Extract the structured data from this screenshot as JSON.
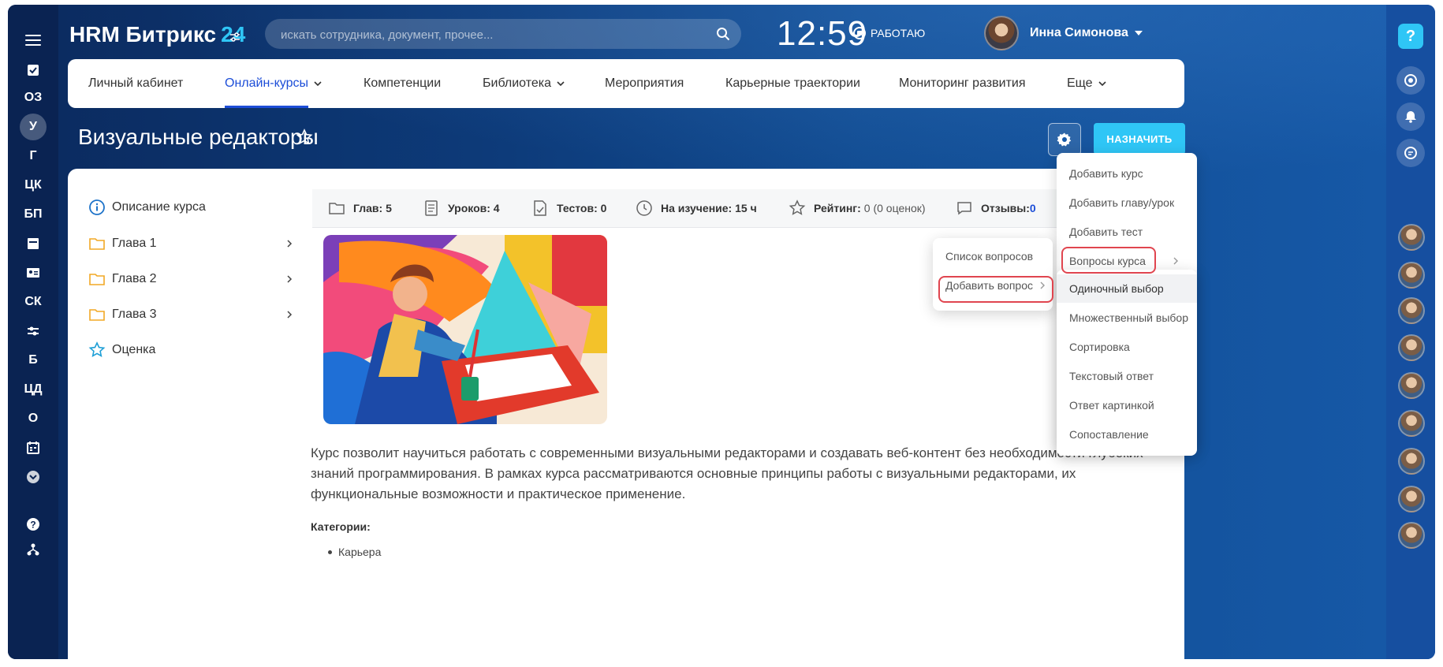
{
  "app": {
    "logo_main": "HRM Битрикс",
    "logo_suffix": "24"
  },
  "search": {
    "placeholder": "искать сотрудника, документ, прочее..."
  },
  "header": {
    "time": "12:59",
    "work_status": "РАБОТАЮ",
    "user_name": "Инна Симонова"
  },
  "left_rail": {
    "items": [
      "ОЗ",
      "У",
      "Г",
      "ЦК",
      "БП",
      "СК",
      "Б",
      "ЦД",
      "О"
    ]
  },
  "nav": {
    "items": [
      {
        "label": "Личный кабинет"
      },
      {
        "label": "Онлайн-курсы"
      },
      {
        "label": "Компетенции"
      },
      {
        "label": "Библиотека"
      },
      {
        "label": "Мероприятия"
      },
      {
        "label": "Карьерные траектории"
      },
      {
        "label": "Мониторинг развития"
      },
      {
        "label": "Еще"
      }
    ]
  },
  "page": {
    "title": "Визуальные редакторы",
    "assign_label": "НАЗНАЧИТЬ"
  },
  "sidebar": {
    "items": [
      {
        "label": "Описание курса"
      },
      {
        "label": "Глава 1"
      },
      {
        "label": "Глава 2"
      },
      {
        "label": "Глава 3"
      },
      {
        "label": "Оценка"
      }
    ]
  },
  "stats": {
    "chapters": "Глав: 5",
    "lessons": "Уроков: 4",
    "tests": "Тестов: 0",
    "study_time": "На изучение: 15 ч",
    "rating_label": "Рейтинг:",
    "rating_value": "0 (0 оценок)",
    "reviews_label": "Отзывы:",
    "reviews_value": "0"
  },
  "course": {
    "description": "Курс позволит научиться работать с современными визуальными редакторами и создавать веб-контент без необходимости глубоких знаний программирования. В рамках курса рассматриваются основные принципы работы с визуальными редакторами, их функциональные возможности и практическое применение.",
    "categories_label": "Категории:",
    "categories": [
      "Карьера"
    ]
  },
  "settings_menu": {
    "items": [
      "Добавить курс",
      "Добавить главу/урок",
      "Добавить тест",
      "Вопросы курса"
    ]
  },
  "questions_menu": {
    "items": [
      "Список вопросов",
      "Добавить вопрос"
    ]
  },
  "add_question_menu": {
    "items": [
      "Одиночный выбор",
      "Множественный выбор",
      "Сортировка",
      "Текстовый ответ",
      "Ответ картинкой",
      "Сопоставление"
    ]
  },
  "colors": {
    "accent": "#2fc6f6",
    "active_nav": "#1d4ed8",
    "highlight": "#e0454f",
    "bg_dark": "#0b2a5e"
  }
}
